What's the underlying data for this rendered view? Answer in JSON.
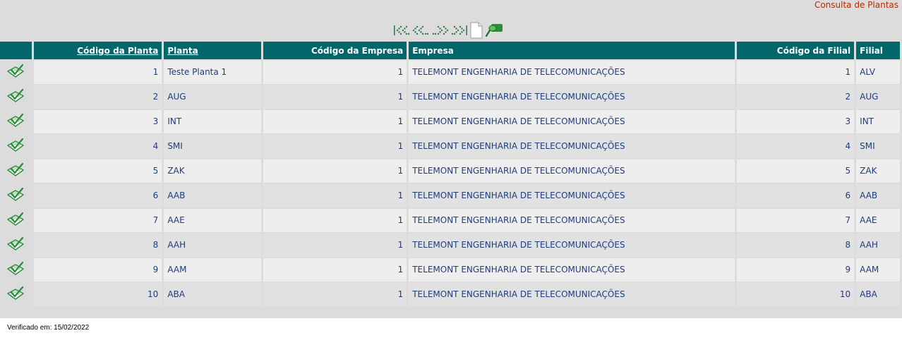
{
  "page": {
    "title": "Consulta de Plantas"
  },
  "toolbar": {
    "buttons": [
      {
        "name": "first-page-icon"
      },
      {
        "name": "previous-page-icon"
      },
      {
        "name": "next-page-icon"
      },
      {
        "name": "last-page-icon"
      },
      {
        "name": "new-document-icon"
      },
      {
        "name": "search-icon"
      }
    ]
  },
  "table": {
    "headers": {
      "codigo_planta": "Código da Planta",
      "planta": "Planta",
      "codigo_empresa": "Código da Empresa",
      "empresa": "Empresa",
      "codigo_filial": "Código da Filial",
      "filial": "Filial"
    },
    "rows": [
      {
        "codigo_planta": "1",
        "planta": "Teste Planta 1",
        "codigo_empresa": "1",
        "empresa": "TELEMONT ENGENHARIA DE TELECOMUNICAÇÕES",
        "codigo_filial": "1",
        "filial": "ALV"
      },
      {
        "codigo_planta": "2",
        "planta": "AUG",
        "codigo_empresa": "1",
        "empresa": "TELEMONT ENGENHARIA DE TELECOMUNICAÇÕES",
        "codigo_filial": "2",
        "filial": "AUG"
      },
      {
        "codigo_planta": "3",
        "planta": "INT",
        "codigo_empresa": "1",
        "empresa": "TELEMONT ENGENHARIA DE TELECOMUNICAÇÕES",
        "codigo_filial": "3",
        "filial": "INT"
      },
      {
        "codigo_planta": "4",
        "planta": "SMI",
        "codigo_empresa": "1",
        "empresa": "TELEMONT ENGENHARIA DE TELECOMUNICAÇÕES",
        "codigo_filial": "4",
        "filial": "SMI"
      },
      {
        "codigo_planta": "5",
        "planta": "ZAK",
        "codigo_empresa": "1",
        "empresa": "TELEMONT ENGENHARIA DE TELECOMUNICAÇÕES",
        "codigo_filial": "5",
        "filial": "ZAK"
      },
      {
        "codigo_planta": "6",
        "planta": "AAB",
        "codigo_empresa": "1",
        "empresa": "TELEMONT ENGENHARIA DE TELECOMUNICAÇÕES",
        "codigo_filial": "6",
        "filial": "AAB"
      },
      {
        "codigo_planta": "7",
        "planta": "AAE",
        "codigo_empresa": "1",
        "empresa": "TELEMONT ENGENHARIA DE TELECOMUNICAÇÕES",
        "codigo_filial": "7",
        "filial": "AAE"
      },
      {
        "codigo_planta": "8",
        "planta": "AAH",
        "codigo_empresa": "1",
        "empresa": "TELEMONT ENGENHARIA DE TELECOMUNICAÇÕES",
        "codigo_filial": "8",
        "filial": "AAH"
      },
      {
        "codigo_planta": "9",
        "planta": "AAM",
        "codigo_empresa": "1",
        "empresa": "TELEMONT ENGENHARIA DE TELECOMUNICAÇÕES",
        "codigo_filial": "9",
        "filial": "AAM"
      },
      {
        "codigo_planta": "10",
        "planta": "ABA",
        "codigo_empresa": "1",
        "empresa": "TELEMONT ENGENHARIA DE TELECOMUNICAÇÕES",
        "codigo_filial": "10",
        "filial": "ABA"
      }
    ]
  },
  "footer": {
    "verified": "Verificado em: 15/02/2022"
  },
  "colors": {
    "header_bg": "#03666a",
    "title": "#b22d00",
    "cell_text": "#1f3d7a",
    "row_odd": "#eeeeee",
    "row_even": "#e1e1e1",
    "icon_green": "#2e8b3e"
  }
}
